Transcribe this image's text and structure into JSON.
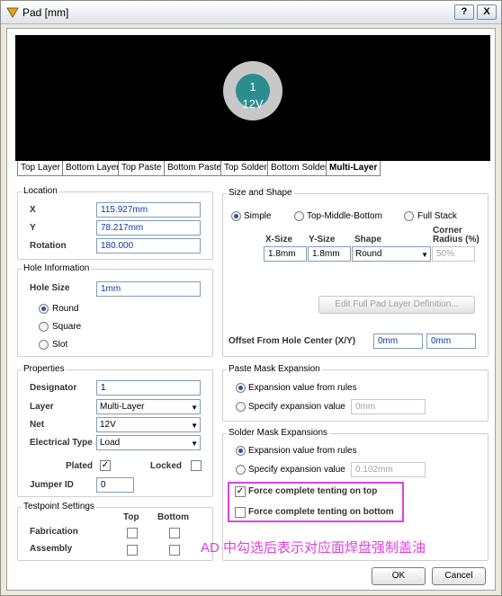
{
  "window": {
    "title": "Pad [mm]",
    "help_label": "?",
    "close_label": "X"
  },
  "preview": {
    "pad_number": "1",
    "pad_net": "12V"
  },
  "tabs": [
    "Top Layer",
    "Bottom Layer",
    "Top Paste",
    "Bottom Paste",
    "Top Solder",
    "Bottom Solder",
    "Multi-Layer"
  ],
  "location": {
    "title": "Location",
    "x_label": "X",
    "x_value": "115.927mm",
    "y_label": "Y",
    "y_value": "78.217mm",
    "rotation_label": "Rotation",
    "rotation_value": "180.000"
  },
  "hole": {
    "title": "Hole Information",
    "size_label": "Hole Size",
    "size_value": "1mm",
    "round": "Round",
    "square": "Square",
    "slot": "Slot"
  },
  "properties": {
    "title": "Properties",
    "designator_label": "Designator",
    "designator_value": "1",
    "layer_label": "Layer",
    "layer_value": "Multi-Layer",
    "net_label": "Net",
    "net_value": "12V",
    "etype_label": "Electrical Type",
    "etype_value": "Load",
    "plated_label": "Plated",
    "locked_label": "Locked",
    "jumper_label": "Jumper ID",
    "jumper_value": "0"
  },
  "testpoint": {
    "title": "Testpoint Settings",
    "top": "Top",
    "bottom": "Bottom",
    "fabrication": "Fabrication",
    "assembly": "Assembly"
  },
  "size_shape": {
    "title": "Size and Shape",
    "simple": "Simple",
    "tmb": "Top-Middle-Bottom",
    "full": "Full Stack",
    "xsize_label": "X-Size",
    "ysize_label": "Y-Size",
    "shape_label": "Shape",
    "corner_label1": "Corner",
    "corner_label2": "Radius (%)",
    "xsize": "1.8mm",
    "ysize": "1.8mm",
    "shape": "Round",
    "corner": "50%",
    "edit_button": "Edit Full Pad Layer Definition...",
    "offset_label": "Offset From Hole Center (X/Y)",
    "offset_x": "0mm",
    "offset_y": "0mm"
  },
  "paste": {
    "title": "Paste Mask Expansion",
    "from_rules": "Expansion value from rules",
    "specify": "Specify expansion value",
    "value": "0mm"
  },
  "solder": {
    "title": "Solder Mask Expansions",
    "from_rules": "Expansion value from rules",
    "specify": "Specify expansion value",
    "value": "0.102mm",
    "tent_top": "Force complete tenting on top",
    "tent_bottom": "Force complete tenting on bottom"
  },
  "annotation": "AD 中勾选后表示对应面焊盘强制盖油",
  "buttons": {
    "ok": "OK",
    "cancel": "Cancel"
  }
}
